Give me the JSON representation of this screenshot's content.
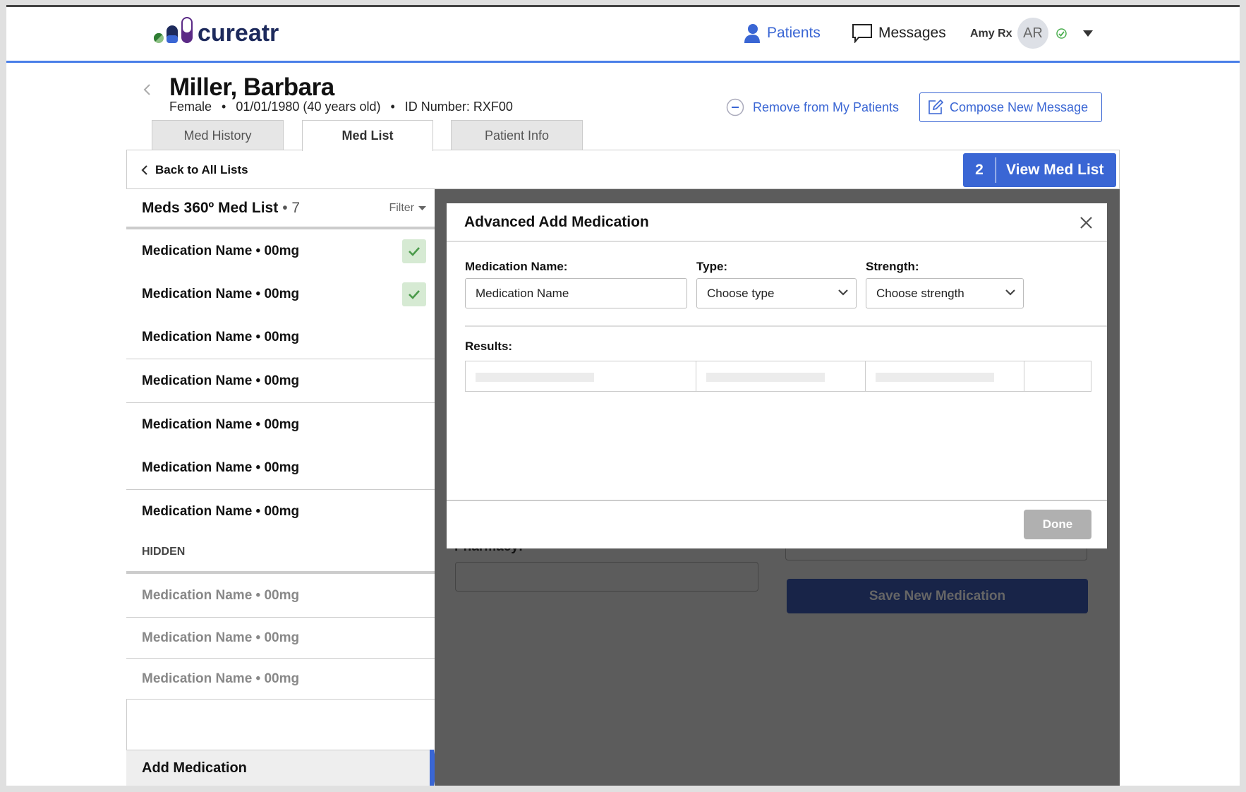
{
  "header": {
    "brand": "cureatr",
    "nav": [
      {
        "label": "Patients",
        "icon": "person-icon"
      },
      {
        "label": "Messages",
        "icon": "chat-bubble-icon"
      }
    ],
    "user_name": "Amy Rx",
    "user_initials": "AR",
    "status": "online",
    "accent": "#3a66d4"
  },
  "patient": {
    "name": "Miller, Barbara",
    "gender": "Female",
    "dob": "01/01/1980 (40 years old)",
    "id": "ID Number: RXF00",
    "remove_label": "Remove from My Patients",
    "compose_label": "Compose New Message"
  },
  "tabs": [
    {
      "label": "Med History"
    },
    {
      "label": "Med List",
      "active": true
    },
    {
      "label": "Patient Info"
    }
  ],
  "toolbar": {
    "back_label": "Back to All Lists",
    "view_count": "2",
    "view_label": "View Med List"
  },
  "list": {
    "title": "Meds 360º Med List",
    "count": "• 7",
    "filter_label": "Filter",
    "items": [
      {
        "label": "Medication Name • 00mg",
        "checked": true
      },
      {
        "label": "Medication Name • 00mg",
        "checked": true
      },
      {
        "label": "Medication Name • 00mg"
      },
      {
        "label": "Medication Name • 00mg"
      },
      {
        "label": "Medication Name • 00mg"
      },
      {
        "label": "Medication Name • 00mg"
      },
      {
        "label": "Medication Name • 00mg"
      }
    ],
    "hidden_header": "HIDDEN",
    "hidden_items": [
      {
        "label": "Medication Name • 00mg"
      },
      {
        "label": "Medication Name • 00mg"
      },
      {
        "label": "Medication Name • 00mg"
      }
    ],
    "add_label": "Add Medication"
  },
  "background_form": {
    "pharmacy_label": "Pharmacy:",
    "save_label": "Save New Medication"
  },
  "modal": {
    "title": "Advanced Add Medication",
    "name_label": "Medication Name:",
    "name_value": "Medication Name",
    "type_label": "Type:",
    "type_value": "Choose type",
    "strength_label": "Strength:",
    "strength_value": "Choose strength",
    "results_label": "Results:",
    "done_label": "Done"
  }
}
